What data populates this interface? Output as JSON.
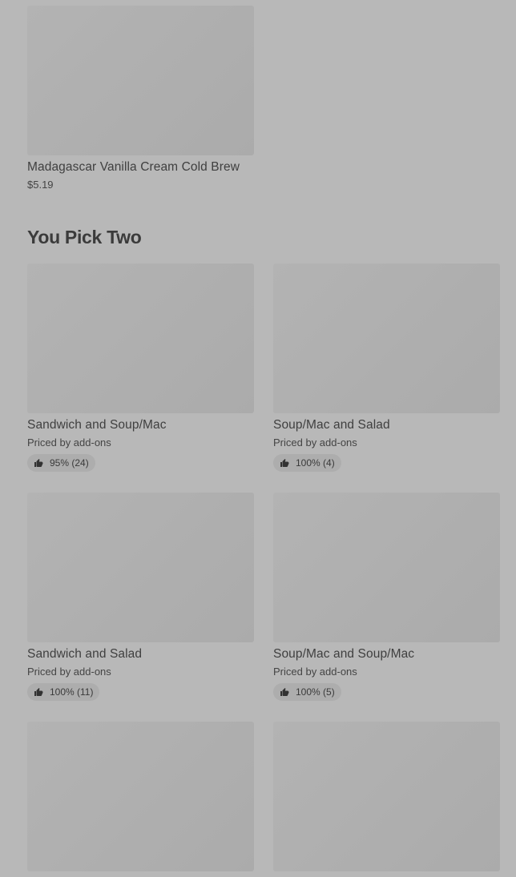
{
  "top_item": {
    "name": "Madagascar Vanilla Cream Cold Brew",
    "price": "$5.19"
  },
  "section": {
    "title": "You Pick Two"
  },
  "items": [
    {
      "name": "Sandwich and Soup/Mac",
      "price": "Priced by add-ons",
      "rating": "95% (24)"
    },
    {
      "name": "Soup/Mac and Salad",
      "price": "Priced by add-ons",
      "rating": "100% (4)"
    },
    {
      "name": "Sandwich and Salad",
      "price": "Priced by add-ons",
      "rating": "100% (11)"
    },
    {
      "name": "Soup/Mac and Soup/Mac",
      "price": "Priced by add-ons",
      "rating": "100% (5)"
    }
  ],
  "icons": {
    "rating": "thumbs-up-icon"
  },
  "colors": {
    "overlay_background": "#b8b8b8",
    "image_placeholder": "#afafaf"
  }
}
